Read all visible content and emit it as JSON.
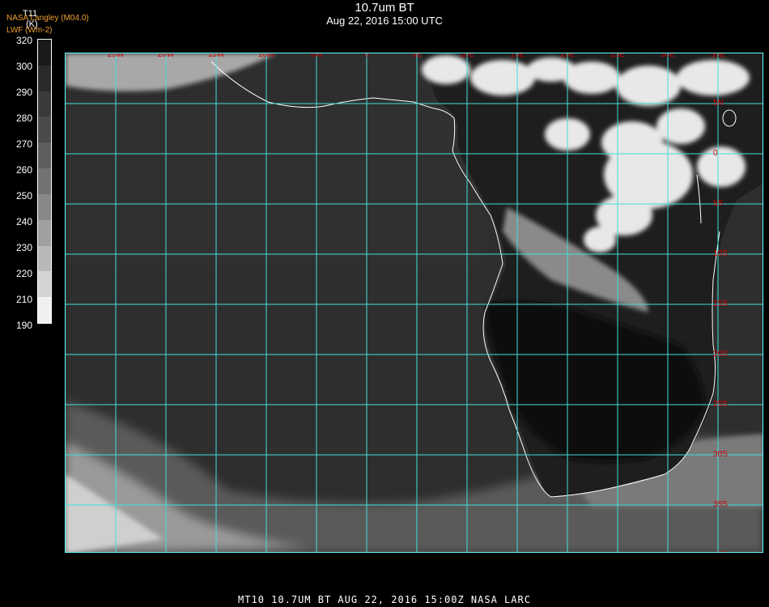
{
  "header": {
    "title": "10.7um BT",
    "subtitle": "Aug 22, 2016 15:00 UTC",
    "nasa_label": "NASA Langley (M04.0)",
    "lwf_label": "LWF (Wm-2)"
  },
  "colorbar": {
    "variable": "T11",
    "unit": "(K)",
    "ticks": [
      "320",
      "300",
      "290",
      "280",
      "270",
      "260",
      "250",
      "240",
      "230",
      "220",
      "210",
      "190"
    ],
    "colors": [
      "#1a1a1a",
      "#2a2a2a",
      "#3a3a3a",
      "#4a4a4a",
      "#5e5e5e",
      "#727272",
      "#888888",
      "#a0a0a0",
      "#b8b8b8",
      "#d4d4d4",
      "#f0f0f0"
    ]
  },
  "map": {
    "lon_labels": [
      "25W",
      "20W",
      "15W",
      "10W",
      "5W",
      "0",
      "5E",
      "10E",
      "15E",
      "20E",
      "25E",
      "30E",
      "35E"
    ],
    "lat_labels": [
      "5N",
      "0",
      "5S",
      "10S",
      "15S",
      "20S",
      "25S",
      "30S",
      "35S",
      "40S"
    ],
    "grid_color": "#44dddd",
    "coast_color": "#ffffff"
  },
  "footer": {
    "text": "MT10   10.7UM BT    AUG 22, 2016 15:00Z    NASA LARC"
  }
}
